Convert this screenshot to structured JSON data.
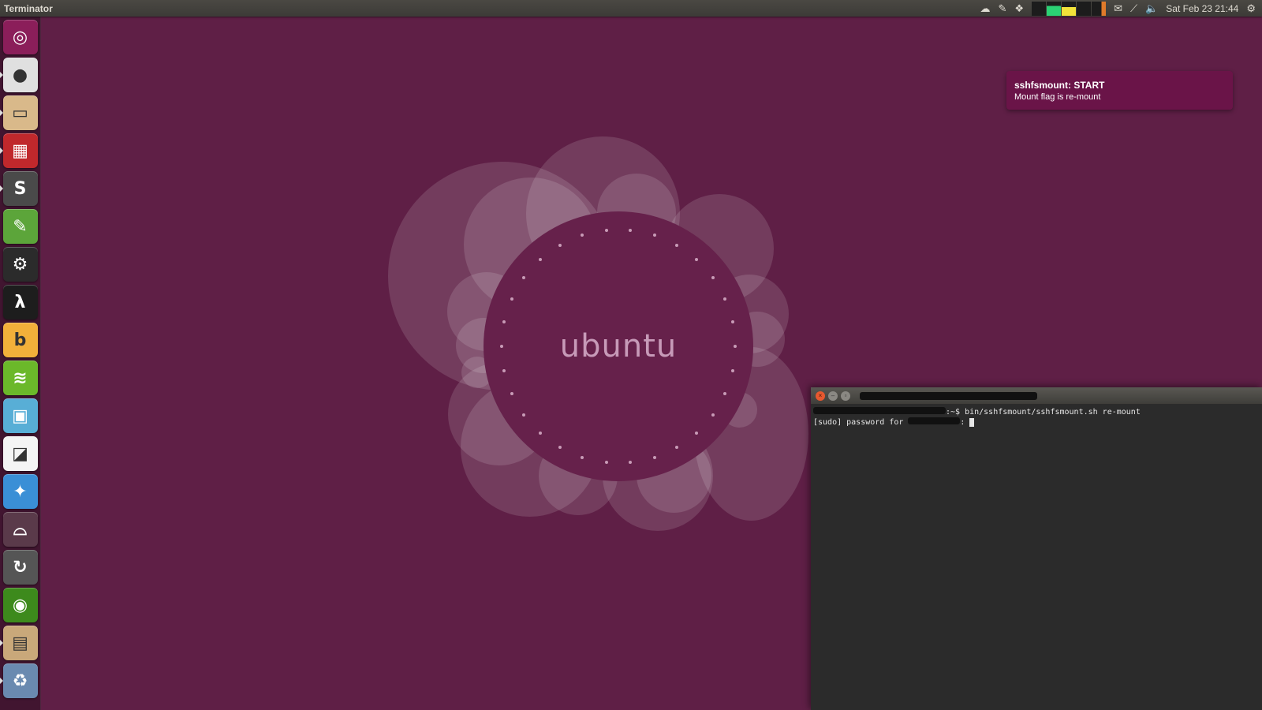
{
  "panel": {
    "app_title": "Terminator",
    "clock": "Sat Feb 23 21:44",
    "indicators": [
      "cloud-icon",
      "pin-icon",
      "dropbox-icon",
      "system-monitor",
      "mail-icon",
      "network-icon",
      "volume-icon",
      "gear-icon"
    ]
  },
  "launcher": {
    "items": [
      {
        "name": "dash-home",
        "glyph": "◎",
        "bg": "#8b1e5a"
      },
      {
        "name": "chrome",
        "glyph": "●",
        "bg": "#e0e0e0"
      },
      {
        "name": "files",
        "glyph": "▭",
        "bg": "#d9b98a"
      },
      {
        "name": "terminator",
        "glyph": "▦",
        "bg": "#c0282c"
      },
      {
        "name": "sublime-text",
        "glyph": "S",
        "bg": "#4a4a4a"
      },
      {
        "name": "evernote",
        "glyph": "✎",
        "bg": "#5ca53a"
      },
      {
        "name": "steam",
        "glyph": "⚙",
        "bg": "#2b2b2b"
      },
      {
        "name": "half-life",
        "glyph": "λ",
        "bg": "#1d1d1d"
      },
      {
        "name": "bitcoin",
        "glyph": "b",
        "bg": "#f2b03a"
      },
      {
        "name": "spotify",
        "glyph": "≋",
        "bg": "#6bb82a"
      },
      {
        "name": "virtualbox",
        "glyph": "▣",
        "bg": "#58aed6"
      },
      {
        "name": "mysql-workbench",
        "glyph": "◪",
        "bg": "#f4f4f4"
      },
      {
        "name": "remmina",
        "glyph": "✦",
        "bg": "#3a8fd6"
      },
      {
        "name": "hat-app",
        "glyph": "⌓",
        "bg": "#5a3a4a"
      },
      {
        "name": "update-manager",
        "glyph": "↻",
        "bg": "#555555"
      },
      {
        "name": "nvidia-settings",
        "glyph": "◉",
        "bg": "#3d8a1c"
      },
      {
        "name": "software-center",
        "glyph": "▤",
        "bg": "#c9a87a"
      },
      {
        "name": "trash",
        "glyph": "♻",
        "bg": "#6a8ab0"
      }
    ]
  },
  "wallpaper": {
    "wordmark": "ubuntu"
  },
  "notification": {
    "title": "sshfsmount: START",
    "body": "Mount flag is re-mount"
  },
  "terminal": {
    "line1_suffix": ":~$ bin/sshfsmount/sshfsmount.sh re-mount",
    "line2_prefix": "[sudo] password for ",
    "line2_suffix": ":"
  }
}
